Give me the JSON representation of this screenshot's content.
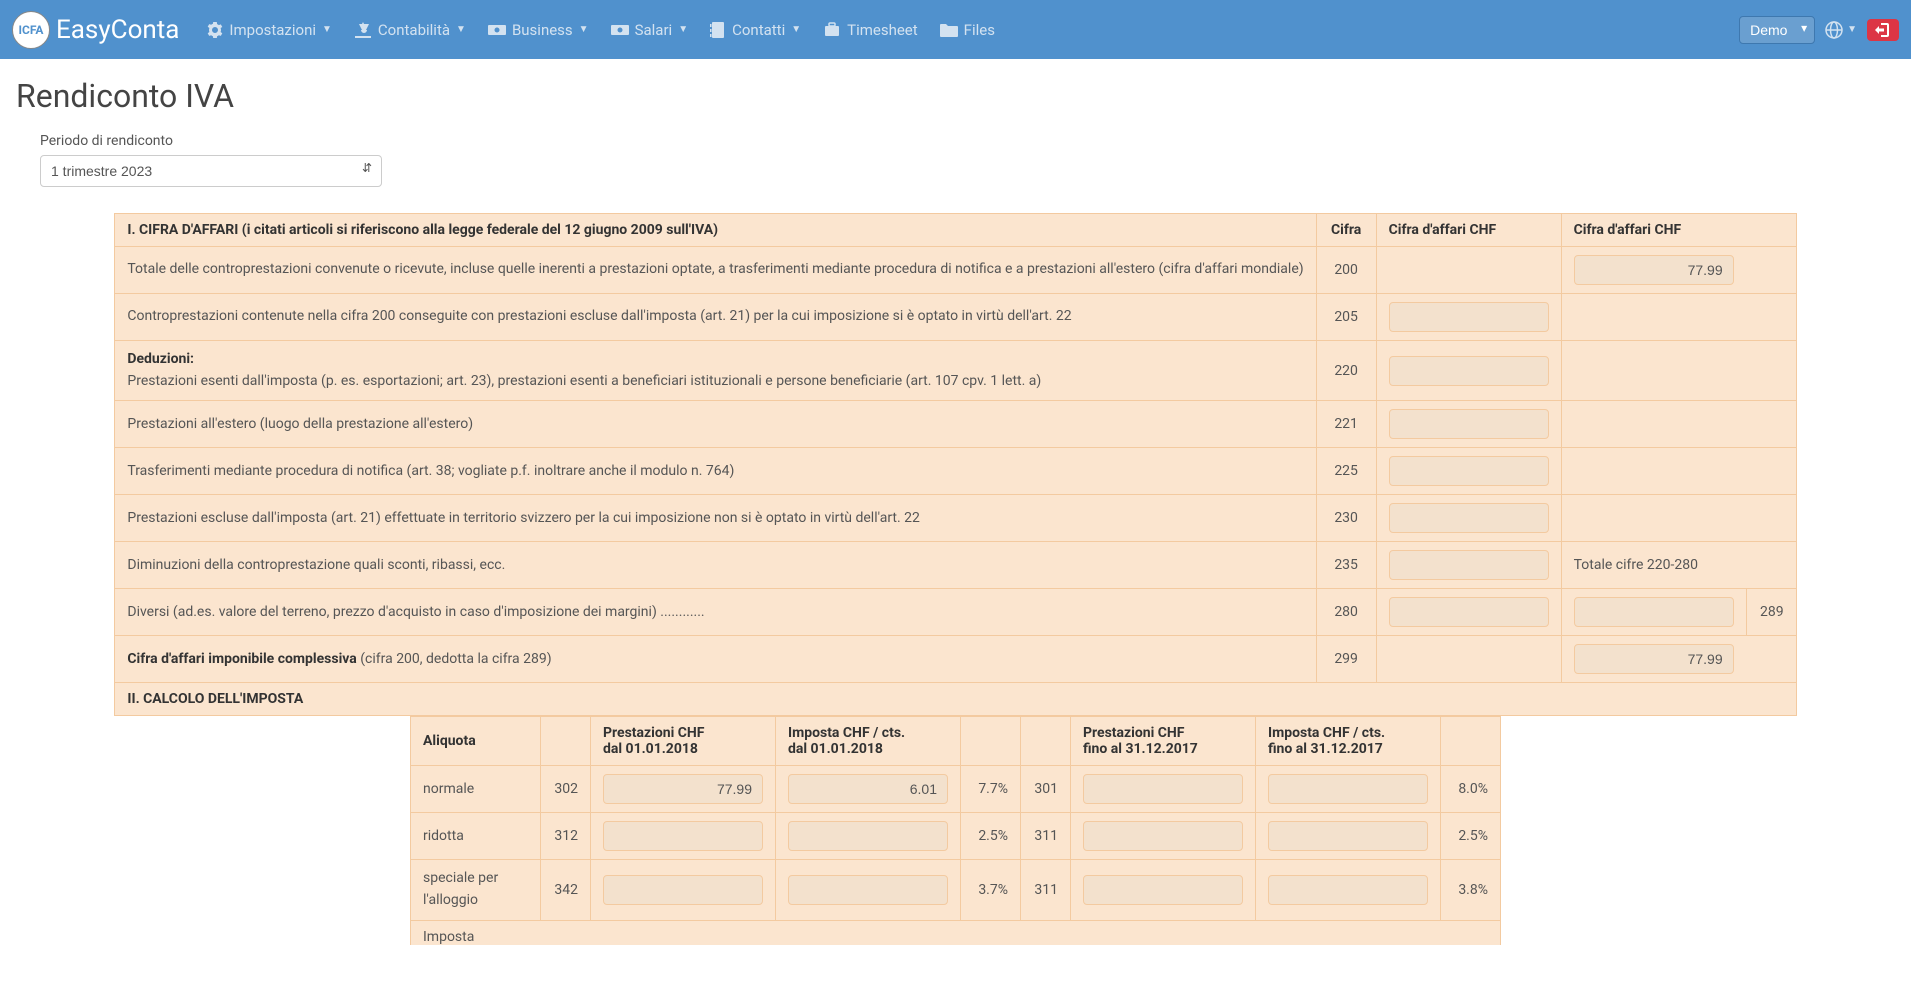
{
  "app": {
    "brand": "EasyConta",
    "logo_text": "ICFA"
  },
  "nav": {
    "items": [
      {
        "label": "Impostazioni",
        "caret": true
      },
      {
        "label": "Contabilità",
        "caret": true
      },
      {
        "label": "Business",
        "caret": true
      },
      {
        "label": "Salari",
        "caret": true
      },
      {
        "label": "Contatti",
        "caret": true
      },
      {
        "label": "Timesheet",
        "caret": false
      },
      {
        "label": "Files",
        "caret": false
      }
    ],
    "demo_label": "Demo"
  },
  "page": {
    "title": "Rendiconto IVA",
    "period_label": "Periodo di rendiconto",
    "period_value": "1 trimestre 2023"
  },
  "section1": {
    "header": "I. CIFRA D'AFFARI (i citati articoli si riferiscono alla legge federale del 12 giugno 2009 sull'IVA)",
    "col_cifra": "Cifra",
    "col_chf1": "Cifra d'affari CHF",
    "col_chf2": "Cifra d'affari CHF",
    "row200_desc": "Totale delle controprestazioni convenute o ricevute, incluse quelle inerenti a prestazioni optate, a trasferimenti mediante procedura di notifica e a prestazioni all'estero (cifra d'affari mondiale)",
    "row200_cifra": "200",
    "row200_val": "77.99",
    "row205_desc": "Controprestazioni contenute nella cifra 200 conseguite con prestazioni escluse dall'imposta (art. 21) per la cui imposizione si è optato in virtù dell'art. 22",
    "row205_cifra": "205",
    "deduzioni": "Deduzioni:",
    "row220_desc": "Prestazioni esenti dall'imposta (p. es. esportazioni; art. 23), prestazioni esenti a beneficiari istituzionali e persone beneficiarie (art. 107 cpv. 1 lett. a)",
    "row220_cifra": "220",
    "row221_desc": "Prestazioni all'estero (luogo della prestazione all'estero)",
    "row221_cifra": "221",
    "row225_desc": "Trasferimenti mediante procedura di notifica (art. 38; vogliate p.f. inoltrare anche il modulo n. 764)",
    "row225_cifra": "225",
    "row230_desc": "Prestazioni escluse dall'imposta (art. 21) effettuate in territorio svizzero per la cui imposizione non si è optato in virtù dell'art. 22",
    "row230_cifra": "230",
    "row235_desc": "Diminuzioni della controprestazione quali sconti, ribassi, ecc.",
    "row235_cifra": "235",
    "row235_note": "Totale cifre 220-280",
    "row280_desc": "Diversi (ad.es. valore del terreno, prezzo d'acquisto in caso d'imposizione dei margini) ............",
    "row280_cifra": "280",
    "row280_code": "289",
    "row299_desc_bold": "Cifra d'affari imponibile complessiva",
    "row299_desc_rest": " (cifra 200, dedotta la cifra 289)",
    "row299_cifra": "299",
    "row299_val": "77.99"
  },
  "section2": {
    "header": "II. CALCOLO DELL'IMPOSTA",
    "aliquota_hdr": "Aliquota",
    "prestazioni_new": "Prestazioni CHF\ndal 01.01.2018",
    "imposta_new": "Imposta CHF / cts.\ndal 01.01.2018",
    "prestazioni_old": "Prestazioni CHF\nfino al 31.12.2017",
    "imposta_old": "Imposta CHF / cts.\nfino al 31.12.2017",
    "rows": [
      {
        "label": "normale",
        "code_new": "302",
        "prest_new": "77.99",
        "imp_new": "6.01",
        "pct_new": "7.7%",
        "code_old": "301",
        "pct_old": "8.0%"
      },
      {
        "label": "ridotta",
        "code_new": "312",
        "prest_new": "",
        "imp_new": "",
        "pct_new": "2.5%",
        "code_old": "311",
        "pct_old": "2.5%"
      },
      {
        "label": "speciale per l'alloggio",
        "code_new": "342",
        "prest_new": "",
        "imp_new": "",
        "pct_new": "3.7%",
        "code_old": "311",
        "pct_old": "3.8%"
      }
    ],
    "bottom_cut": "Imposta"
  }
}
